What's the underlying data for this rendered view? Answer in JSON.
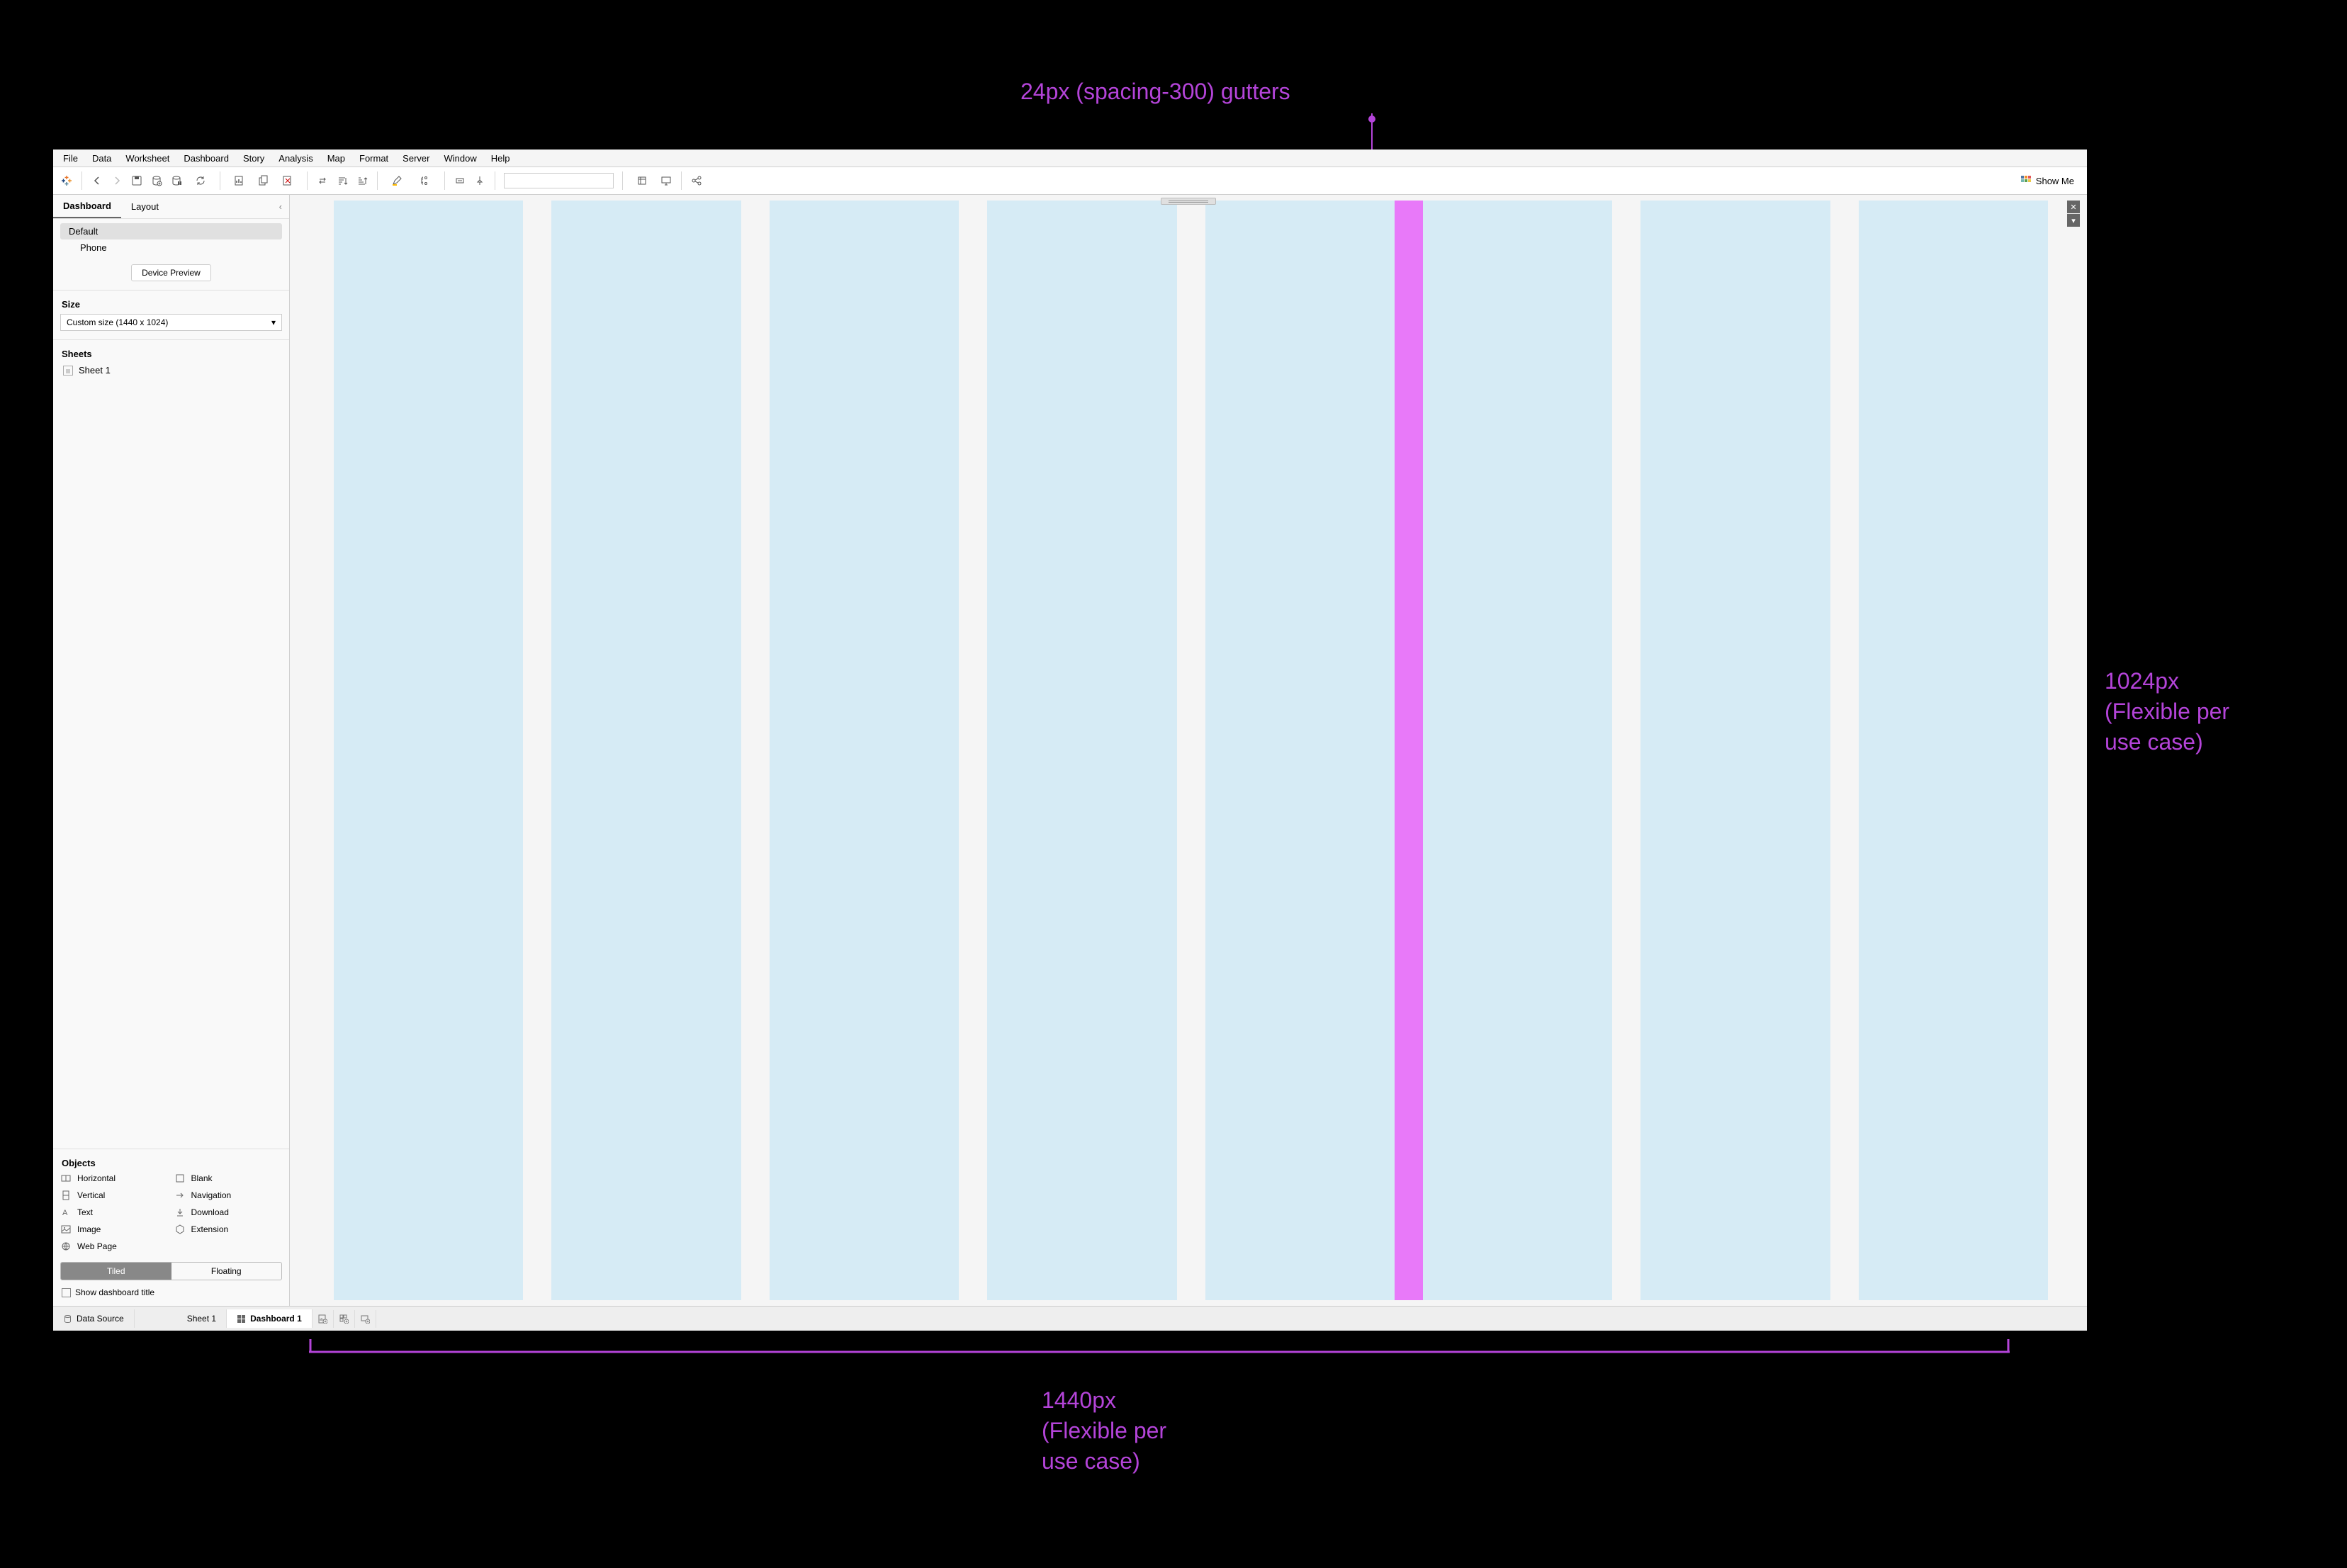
{
  "annotations": {
    "top": "24px (spacing-300) gutters",
    "right_line1": "1024px",
    "right_line2": "(Flexible per",
    "right_line3": "use case)",
    "bottom_line1": "1440px",
    "bottom_line2": "(Flexible per",
    "bottom_line3": "use case)"
  },
  "menu": [
    "File",
    "Data",
    "Worksheet",
    "Dashboard",
    "Story",
    "Analysis",
    "Map",
    "Format",
    "Server",
    "Window",
    "Help"
  ],
  "showme": "Show Me",
  "sidebar": {
    "tab_dashboard": "Dashboard",
    "tab_layout": "Layout",
    "device_default": "Default",
    "device_phone": "Phone",
    "device_preview": "Device Preview",
    "size_label": "Size",
    "size_value": "Custom size (1440 x 1024)",
    "sheets_label": "Sheets",
    "sheet1": "Sheet 1",
    "objects_label": "Objects",
    "objects": {
      "horizontal": "Horizontal",
      "blank": "Blank",
      "vertical": "Vertical",
      "navigation": "Navigation",
      "text": "Text",
      "download": "Download",
      "image": "Image",
      "extension": "Extension",
      "webpage": "Web Page"
    },
    "tiled": "Tiled",
    "floating": "Floating",
    "show_title": "Show dashboard title"
  },
  "bottom": {
    "datasource": "Data Source",
    "sheet1": "Sheet 1",
    "dashboard1": "Dashboard 1"
  }
}
